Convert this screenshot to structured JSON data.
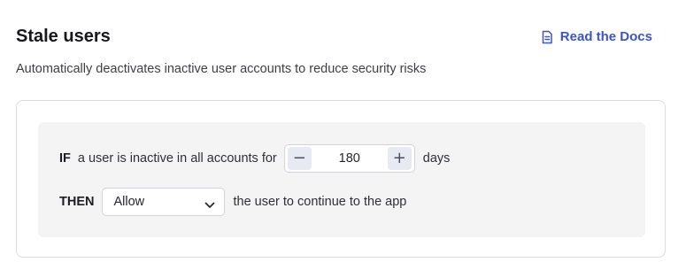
{
  "header": {
    "title": "Stale users",
    "docs_label": "Read the Docs",
    "subtitle": "Automatically deactivates inactive user accounts to reduce security risks"
  },
  "rule": {
    "if_keyword": "IF",
    "if_text": "a user is inactive in all accounts for",
    "days_value": "180",
    "days_unit": "days",
    "decrement_symbol": "−",
    "increment_symbol": "+",
    "then_keyword": "THEN",
    "action_selected": "Allow",
    "then_text": "the user to continue to the app"
  },
  "colors": {
    "accent": "#3a55c7",
    "rule_background": "#f4f4f5",
    "stepper_button": "#e8eaf3"
  },
  "icons": {
    "docs": "document-icon",
    "dropdown": "chevron-down-icon"
  }
}
